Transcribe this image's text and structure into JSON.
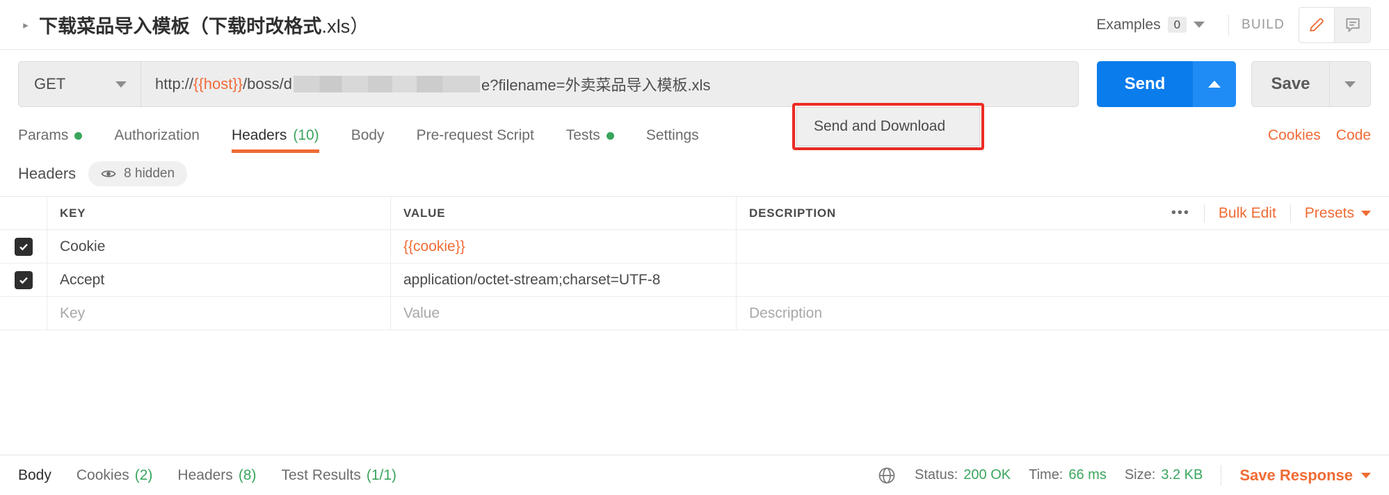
{
  "titlebar": {
    "disclosure_icon": "triangle-right-icon",
    "request_title_main": "下载菜品导入模板（下载时改格式",
    "request_title_ext": ".xls）",
    "examples_label": "Examples",
    "examples_count": "0",
    "build_label": "BUILD",
    "edit_icon": "pencil-icon",
    "comment_icon": "comment-icon",
    "accent_orange": "#ef6b35"
  },
  "urlbar": {
    "method": "GET",
    "url_prefix": "http://",
    "url_variable": "{{host}}",
    "url_mid": "/boss/d",
    "url_redacted": "redacted-block",
    "url_suffix": "e?filename=外卖菜品导入模板.xls",
    "send_label": "Send",
    "send_caret_icon": "chevron-up-icon",
    "save_label": "Save",
    "save_caret_icon": "chevron-down-icon",
    "send_color": "#0a7cec"
  },
  "send_dropdown": {
    "item_label": "Send and Download",
    "highlight_color": "#ee2b24"
  },
  "request_tabs": {
    "items": [
      {
        "label": "Params",
        "badge": "",
        "dot": true,
        "active": false
      },
      {
        "label": "Authorization",
        "badge": "",
        "dot": false,
        "active": false
      },
      {
        "label": "Headers",
        "badge": "(10)",
        "dot": false,
        "active": true
      },
      {
        "label": "Body",
        "badge": "",
        "dot": false,
        "active": false
      },
      {
        "label": "Pre-request Script",
        "badge": "",
        "dot": false,
        "active": false
      },
      {
        "label": "Tests",
        "badge": "",
        "dot": true,
        "active": false
      },
      {
        "label": "Settings",
        "badge": "",
        "dot": false,
        "active": false
      }
    ],
    "cookies_link": "Cookies",
    "code_link": "Code"
  },
  "headers_section": {
    "label": "Headers",
    "hidden_icon": "eye-icon",
    "hidden_text": "8 hidden"
  },
  "headers_table": {
    "columns": [
      "KEY",
      "VALUE",
      "DESCRIPTION"
    ],
    "tools": {
      "more_icon": "ellipsis-icon",
      "bulk_edit": "Bulk Edit",
      "presets": "Presets",
      "presets_caret": "chevron-down-icon"
    },
    "rows": [
      {
        "checked": true,
        "key": "Cookie",
        "value": "{{cookie}}",
        "value_is_variable": true,
        "description": ""
      },
      {
        "checked": true,
        "key": "Accept",
        "value": "application/octet-stream;charset=UTF-8",
        "value_is_variable": false,
        "description": ""
      }
    ],
    "placeholder_row": {
      "key": "Key",
      "value": "Value",
      "description": "Description"
    }
  },
  "footer": {
    "tabs": [
      {
        "label": "Body",
        "badge": "",
        "active": true
      },
      {
        "label": "Cookies",
        "badge": "(2)",
        "active": false
      },
      {
        "label": "Headers",
        "badge": "(8)",
        "active": false
      },
      {
        "label": "Test Results",
        "badge": "(1/1)",
        "active": false
      }
    ],
    "globe_icon": "globe-icon",
    "status_label": "Status:",
    "status_value": "200 OK",
    "time_label": "Time:",
    "time_value": "66 ms",
    "size_label": "Size:",
    "size_value": "3.2 KB",
    "save_response": "Save Response",
    "save_response_caret": "chevron-down-icon",
    "success_color": "#3aa55d"
  }
}
